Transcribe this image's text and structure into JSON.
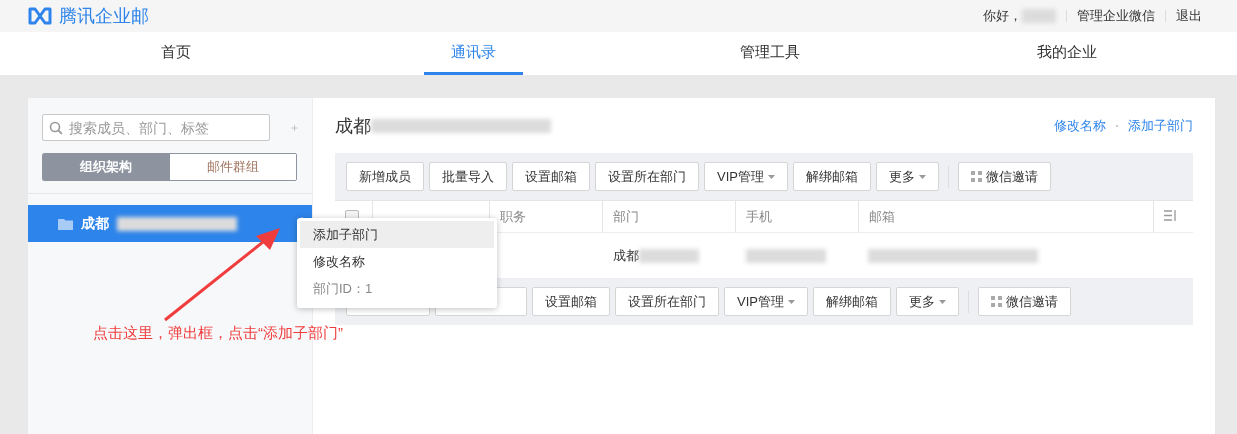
{
  "header": {
    "brand": "腾讯企业邮",
    "greeting": "你好，",
    "links": [
      "管理企业微信",
      "退出"
    ]
  },
  "nav": [
    {
      "label": "首页",
      "selected": false
    },
    {
      "label": "通讯录",
      "selected": true
    },
    {
      "label": "管理工具",
      "selected": false
    },
    {
      "label": "我的企业",
      "selected": false
    }
  ],
  "sidebar": {
    "search": {
      "placeholder": "搜索成员、部门、标签"
    },
    "segments": [
      {
        "label": "组织架构",
        "selected": true
      },
      {
        "label": "邮件群组",
        "selected": false
      }
    ],
    "tree": [
      {
        "label": "成都",
        "selected": true
      }
    ]
  },
  "context_menu": [
    {
      "label": "添加子部门",
      "kind": "action",
      "hovered": true
    },
    {
      "label": "修改名称",
      "kind": "action",
      "hovered": false
    },
    {
      "label": "部门ID：1",
      "kind": "info",
      "hovered": false
    }
  ],
  "department": {
    "title": "成都",
    "links": [
      "修改名称",
      "添加子部门"
    ]
  },
  "toolbar_top": [
    {
      "label": "新增成员",
      "kind": "plain"
    },
    {
      "label": "批量导入",
      "kind": "plain"
    },
    {
      "label": "设置邮箱",
      "kind": "plain"
    },
    {
      "label": "设置所在部门",
      "kind": "plain"
    },
    {
      "label": "VIP管理",
      "kind": "dropdown"
    },
    {
      "label": "解绑邮箱",
      "kind": "plain"
    },
    {
      "label": "更多",
      "kind": "dropdown"
    },
    {
      "label": "微信邀请",
      "kind": "invite"
    }
  ],
  "table": {
    "columns": [
      "职务",
      "部门",
      "手机",
      "邮箱"
    ],
    "checked": false,
    "rows": [
      {
        "department": "成都"
      }
    ]
  },
  "toolbar_bottom": [
    {
      "kind": "covered"
    },
    {
      "kind": "covered"
    },
    {
      "label": "设置邮箱",
      "kind": "plain"
    },
    {
      "label": "设置所在部门",
      "kind": "plain"
    },
    {
      "label": "VIP管理",
      "kind": "dropdown"
    },
    {
      "label": "解绑邮箱",
      "kind": "plain"
    },
    {
      "label": "更多",
      "kind": "dropdown"
    },
    {
      "label": "微信邀请",
      "kind": "invite"
    }
  ],
  "annotation": "点击这里，弹出框，点击“添加子部门”"
}
